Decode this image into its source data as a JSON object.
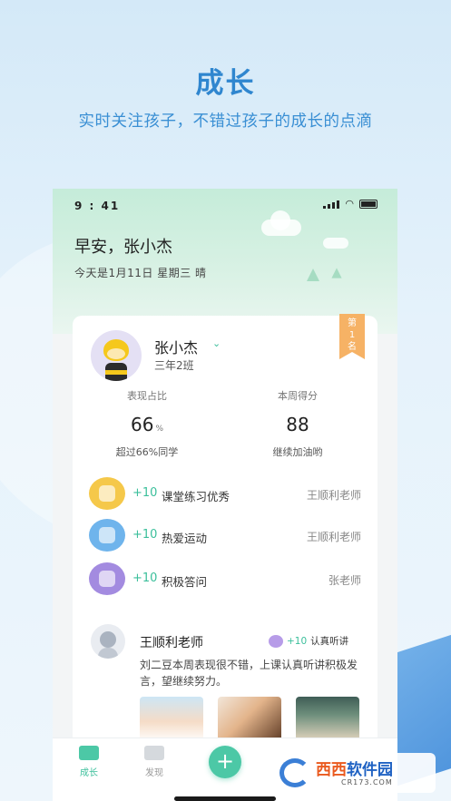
{
  "hero": {
    "title": "成长",
    "subtitle": "实时关注孩子，不错过孩子的成长的点滴"
  },
  "status_bar": {
    "time": "9 : 41"
  },
  "header": {
    "greeting": "早安，张小杰",
    "date_line": "今天是1月11日  星期三  晴"
  },
  "profile": {
    "name": "张小杰",
    "class": "三年2班",
    "rank_badge": "第1名"
  },
  "stats": [
    {
      "label": "表现占比",
      "value": "66",
      "unit": "%",
      "note": "超过66%同学"
    },
    {
      "label": "本周得分",
      "value": "88",
      "unit": "",
      "note": "继续加油哟"
    }
  ],
  "records": [
    {
      "score": "+10",
      "text": "课堂练习优秀",
      "teacher": "王顺利老师",
      "icon": "medal-icon",
      "color": "#f5c84a"
    },
    {
      "score": "+10",
      "text": "热爱运动",
      "teacher": "王顺利老师",
      "icon": "sport-icon",
      "color": "#6fb4ec"
    },
    {
      "score": "+10",
      "text": "积极答问",
      "teacher": "张老师",
      "icon": "hand-raise-icon",
      "color": "#a38be0"
    }
  ],
  "comment": {
    "teacher": "王顺利老师",
    "badge_score": "+10",
    "badge_text": "认真听讲",
    "message": "刘二豆本周表现很不错，上课认真听讲积极发言，望继续努力。"
  },
  "tabbar": {
    "tabs": [
      {
        "label": "成长",
        "active": true
      },
      {
        "label": "发现",
        "active": false
      }
    ],
    "add_label": "+"
  },
  "watermark": {
    "title_a": "西西",
    "title_b": "软件园",
    "url": "CR173.COM"
  },
  "colors": {
    "accent": "#3bbf9b",
    "hero_blue": "#2f86cf",
    "rank_orange": "#f6b265"
  }
}
